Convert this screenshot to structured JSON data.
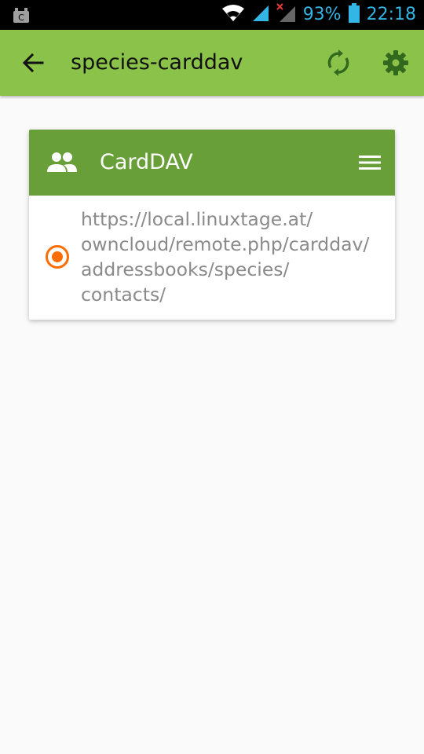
{
  "status_bar": {
    "battery": "93%",
    "time": "22:18"
  },
  "toolbar": {
    "title": "species-carddav",
    "back_icon": "arrow-back-icon",
    "sync_icon": "sync-icon",
    "settings_icon": "gear-icon"
  },
  "card": {
    "title": "CardDAV",
    "header_icon": "people-icon",
    "menu_icon": "hamburger-menu-icon",
    "url": "https://local.linuxtage.at/owncloud/remote.php/carddav/addressbooks/species/contacts/",
    "url_lines": [
      "https://local.linuxtage.at/",
      "owncloud/remote.php/carddav/",
      "addressbooks/species/",
      "contacts/"
    ],
    "selected": true
  },
  "colors": {
    "toolbar": "#8bc34a",
    "card_header": "#689f38",
    "radio": "#ff6d00",
    "status_text": "#33b5e5"
  }
}
